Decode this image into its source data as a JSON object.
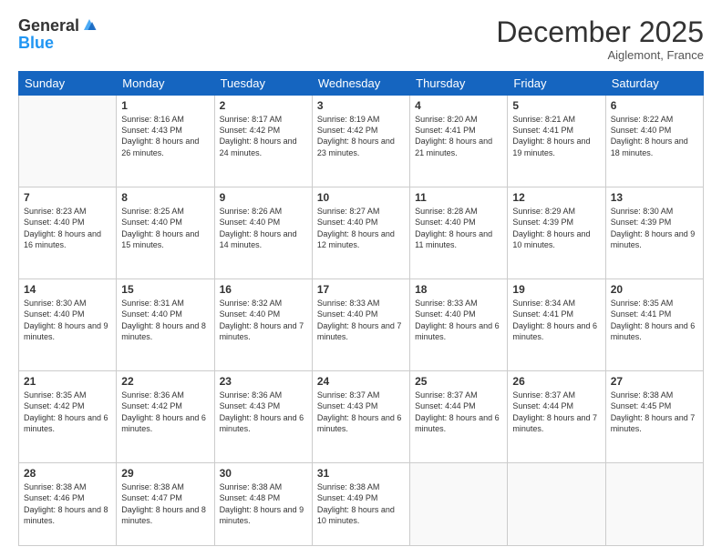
{
  "logo": {
    "general": "General",
    "blue": "Blue"
  },
  "title": "December 2025",
  "location": "Aiglemont, France",
  "weekdays": [
    "Sunday",
    "Monday",
    "Tuesday",
    "Wednesday",
    "Thursday",
    "Friday",
    "Saturday"
  ],
  "weeks": [
    [
      null,
      {
        "day": 1,
        "sunrise": "8:16 AM",
        "sunset": "4:43 PM",
        "daylight": "8 hours and 26 minutes."
      },
      {
        "day": 2,
        "sunrise": "8:17 AM",
        "sunset": "4:42 PM",
        "daylight": "8 hours and 24 minutes."
      },
      {
        "day": 3,
        "sunrise": "8:19 AM",
        "sunset": "4:42 PM",
        "daylight": "8 hours and 23 minutes."
      },
      {
        "day": 4,
        "sunrise": "8:20 AM",
        "sunset": "4:41 PM",
        "daylight": "8 hours and 21 minutes."
      },
      {
        "day": 5,
        "sunrise": "8:21 AM",
        "sunset": "4:41 PM",
        "daylight": "8 hours and 19 minutes."
      },
      {
        "day": 6,
        "sunrise": "8:22 AM",
        "sunset": "4:40 PM",
        "daylight": "8 hours and 18 minutes."
      }
    ],
    [
      {
        "day": 7,
        "sunrise": "8:23 AM",
        "sunset": "4:40 PM",
        "daylight": "8 hours and 16 minutes."
      },
      {
        "day": 8,
        "sunrise": "8:25 AM",
        "sunset": "4:40 PM",
        "daylight": "8 hours and 15 minutes."
      },
      {
        "day": 9,
        "sunrise": "8:26 AM",
        "sunset": "4:40 PM",
        "daylight": "8 hours and 14 minutes."
      },
      {
        "day": 10,
        "sunrise": "8:27 AM",
        "sunset": "4:40 PM",
        "daylight": "8 hours and 12 minutes."
      },
      {
        "day": 11,
        "sunrise": "8:28 AM",
        "sunset": "4:40 PM",
        "daylight": "8 hours and 11 minutes."
      },
      {
        "day": 12,
        "sunrise": "8:29 AM",
        "sunset": "4:39 PM",
        "daylight": "8 hours and 10 minutes."
      },
      {
        "day": 13,
        "sunrise": "8:30 AM",
        "sunset": "4:39 PM",
        "daylight": "8 hours and 9 minutes."
      }
    ],
    [
      {
        "day": 14,
        "sunrise": "8:30 AM",
        "sunset": "4:40 PM",
        "daylight": "8 hours and 9 minutes."
      },
      {
        "day": 15,
        "sunrise": "8:31 AM",
        "sunset": "4:40 PM",
        "daylight": "8 hours and 8 minutes."
      },
      {
        "day": 16,
        "sunrise": "8:32 AM",
        "sunset": "4:40 PM",
        "daylight": "8 hours and 7 minutes."
      },
      {
        "day": 17,
        "sunrise": "8:33 AM",
        "sunset": "4:40 PM",
        "daylight": "8 hours and 7 minutes."
      },
      {
        "day": 18,
        "sunrise": "8:33 AM",
        "sunset": "4:40 PM",
        "daylight": "8 hours and 6 minutes."
      },
      {
        "day": 19,
        "sunrise": "8:34 AM",
        "sunset": "4:41 PM",
        "daylight": "8 hours and 6 minutes."
      },
      {
        "day": 20,
        "sunrise": "8:35 AM",
        "sunset": "4:41 PM",
        "daylight": "8 hours and 6 minutes."
      }
    ],
    [
      {
        "day": 21,
        "sunrise": "8:35 AM",
        "sunset": "4:42 PM",
        "daylight": "8 hours and 6 minutes."
      },
      {
        "day": 22,
        "sunrise": "8:36 AM",
        "sunset": "4:42 PM",
        "daylight": "8 hours and 6 minutes."
      },
      {
        "day": 23,
        "sunrise": "8:36 AM",
        "sunset": "4:43 PM",
        "daylight": "8 hours and 6 minutes."
      },
      {
        "day": 24,
        "sunrise": "8:37 AM",
        "sunset": "4:43 PM",
        "daylight": "8 hours and 6 minutes."
      },
      {
        "day": 25,
        "sunrise": "8:37 AM",
        "sunset": "4:44 PM",
        "daylight": "8 hours and 6 minutes."
      },
      {
        "day": 26,
        "sunrise": "8:37 AM",
        "sunset": "4:44 PM",
        "daylight": "8 hours and 7 minutes."
      },
      {
        "day": 27,
        "sunrise": "8:38 AM",
        "sunset": "4:45 PM",
        "daylight": "8 hours and 7 minutes."
      }
    ],
    [
      {
        "day": 28,
        "sunrise": "8:38 AM",
        "sunset": "4:46 PM",
        "daylight": "8 hours and 8 minutes."
      },
      {
        "day": 29,
        "sunrise": "8:38 AM",
        "sunset": "4:47 PM",
        "daylight": "8 hours and 8 minutes."
      },
      {
        "day": 30,
        "sunrise": "8:38 AM",
        "sunset": "4:48 PM",
        "daylight": "8 hours and 9 minutes."
      },
      {
        "day": 31,
        "sunrise": "8:38 AM",
        "sunset": "4:49 PM",
        "daylight": "8 hours and 10 minutes."
      },
      null,
      null,
      null
    ]
  ]
}
